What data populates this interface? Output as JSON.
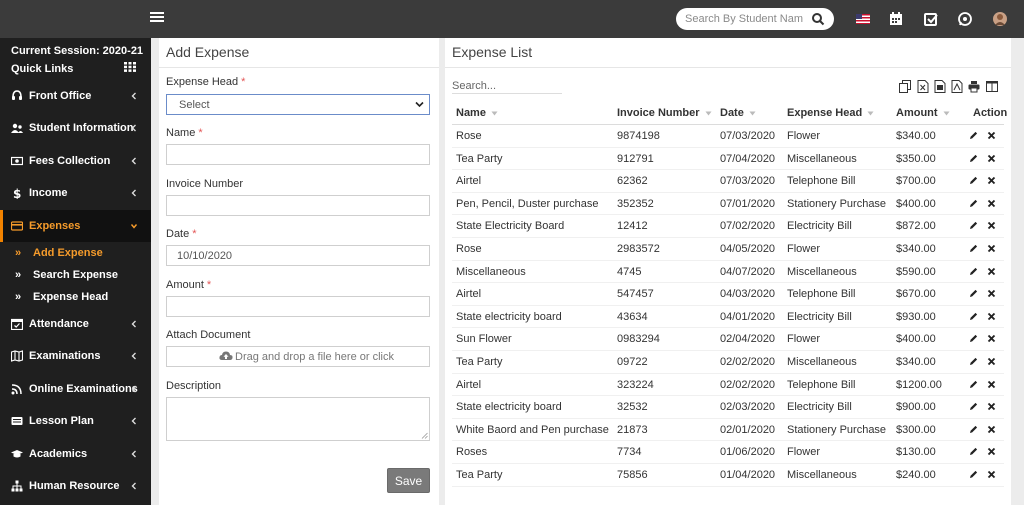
{
  "topbar": {
    "search_placeholder": "Search By Student Name",
    "icons": [
      "menu-icon",
      "search-icon",
      "us-flag-icon",
      "calendar-icon",
      "checkbox-icon",
      "whatsapp-icon",
      "user-avatar"
    ]
  },
  "sidebar": {
    "session": "Current Session: 2020-21",
    "quick_links": "Quick Links",
    "items": [
      {
        "label": "Front Office",
        "icon": "headset-icon"
      },
      {
        "label": "Student Information",
        "icon": "users-icon"
      },
      {
        "label": "Fees Collection",
        "icon": "money-icon"
      },
      {
        "label": "Income",
        "icon": "dollar-icon"
      },
      {
        "label": "Expenses",
        "icon": "card-icon"
      },
      {
        "label": "Attendance",
        "icon": "calendar-check-icon"
      },
      {
        "label": "Examinations",
        "icon": "map-icon"
      },
      {
        "label": "Online Examinations",
        "icon": "rss-icon"
      },
      {
        "label": "Lesson Plan",
        "icon": "list-icon"
      },
      {
        "label": "Academics",
        "icon": "graduation-cap-icon"
      },
      {
        "label": "Human Resource",
        "icon": "sitemap-icon"
      }
    ],
    "subitems": [
      {
        "label": "Add Expense"
      },
      {
        "label": "Search Expense"
      },
      {
        "label": "Expense Head"
      }
    ]
  },
  "add_expense": {
    "title": "Add Expense",
    "expense_head_label": "Expense Head",
    "expense_head_value": "Select",
    "name_label": "Name",
    "invoice_label": "Invoice Number",
    "date_label": "Date",
    "date_value": "10/10/2020",
    "amount_label": "Amount",
    "attach_label": "Attach Document",
    "dropzone_text": "Drag and drop a file here or click",
    "description_label": "Description",
    "save_label": "Save",
    "required_mark": "*"
  },
  "expense_list": {
    "title": "Expense List",
    "search_placeholder": "Search...",
    "columns": [
      "Name",
      "Invoice Number",
      "Date",
      "Expense Head",
      "Amount",
      "Action"
    ],
    "rows": [
      [
        "Rose",
        "9874198",
        "07/03/2020",
        "Flower",
        "$340.00"
      ],
      [
        "Tea Party",
        "912791",
        "07/04/2020",
        "Miscellaneous",
        "$350.00"
      ],
      [
        "Airtel",
        "62362",
        "07/03/2020",
        "Telephone Bill",
        "$700.00"
      ],
      [
        "Pen, Pencil, Duster purchase",
        "352352",
        "07/01/2020",
        "Stationery Purchase",
        "$400.00"
      ],
      [
        "State Electricity Board",
        "12412",
        "07/02/2020",
        "Electricity Bill",
        "$872.00"
      ],
      [
        "Rose",
        "2983572",
        "04/05/2020",
        "Flower",
        "$340.00"
      ],
      [
        "Miscellaneous",
        "4745",
        "04/07/2020",
        "Miscellaneous",
        "$590.00"
      ],
      [
        "Airtel",
        "547457",
        "04/03/2020",
        "Telephone Bill",
        "$670.00"
      ],
      [
        "State electricity board",
        "43634",
        "04/01/2020",
        "Electricity Bill",
        "$930.00"
      ],
      [
        "Sun Flower",
        "0983294",
        "02/04/2020",
        "Flower",
        "$400.00"
      ],
      [
        "Tea Party",
        "09722",
        "02/02/2020",
        "Miscellaneous",
        "$340.00"
      ],
      [
        "Airtel",
        "323224",
        "02/02/2020",
        "Telephone Bill",
        "$1200.00"
      ],
      [
        "State electricity board",
        "32532",
        "02/03/2020",
        "Electricity Bill",
        "$900.00"
      ],
      [
        "White Baord and Pen purchase",
        "21873",
        "02/01/2020",
        "Stationery Purchase",
        "$300.00"
      ],
      [
        "Roses",
        "7734",
        "01/06/2020",
        "Flower",
        "$130.00"
      ],
      [
        "Tea Party",
        "75856",
        "01/04/2020",
        "Miscellaneous",
        "$240.00"
      ]
    ]
  }
}
